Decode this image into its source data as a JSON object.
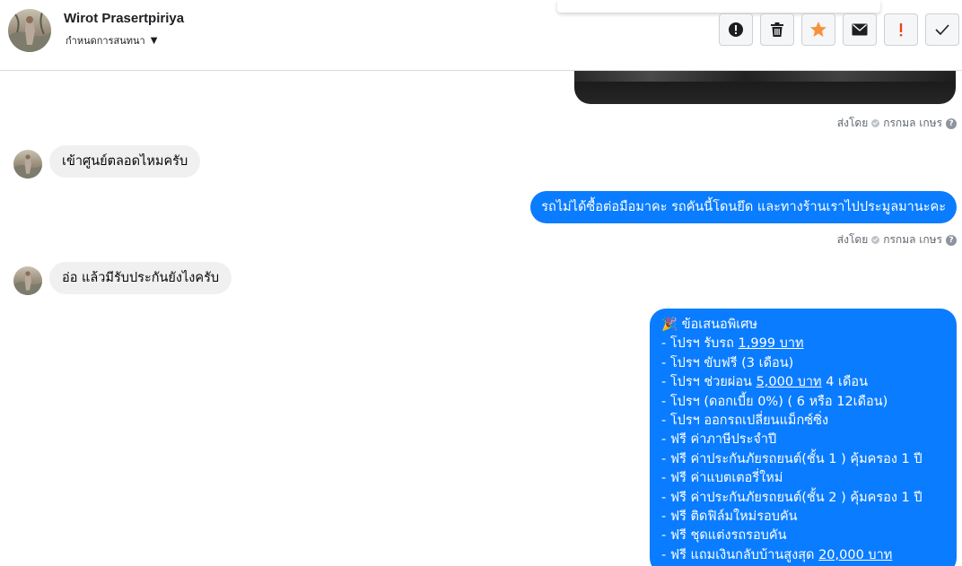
{
  "header": {
    "contact_name": "Wirot Prasertpiriya",
    "conversation_settings": "กำหนดการสนทนา",
    "actions": [
      {
        "icon": "alert-circle-icon"
      },
      {
        "icon": "trash-icon"
      },
      {
        "icon": "star-icon",
        "color": "#f7923b"
      },
      {
        "icon": "envelope-icon"
      },
      {
        "icon": "exclamation-icon",
        "color": "#e9461d"
      },
      {
        "icon": "check-icon"
      }
    ]
  },
  "thread": {
    "sent_by_label": "ส่งโดย",
    "sender_name": "กรกมล เกษร",
    "help_glyph": "?",
    "messages": [
      {
        "direction": "in",
        "text": "เข้าศูนย์ตลอดไหมครับ"
      },
      {
        "direction": "out",
        "text": "รถไม่ได้ซื้อต่อมือมาคะ รถคันนี้โดนยึด และทางร้านเราไปประมูลมานะคะ"
      },
      {
        "direction": "in",
        "text": "อ่อ แล้วมีรับประกันยังไงครับ"
      }
    ],
    "offer": {
      "emoji": "🎉",
      "title": "ข้อเสนอพิเศษ",
      "lines": [
        {
          "pre": "- โปรฯ รับรถ ",
          "link": "1,999 บาท",
          "post": ""
        },
        {
          "pre": "- โปรฯ ขับฟรี (3 เดือน)",
          "link": "",
          "post": ""
        },
        {
          "pre": "- โปรฯ ช่วยผ่อน ",
          "link": "5,000 บาท",
          "post": " 4 เดือน"
        },
        {
          "pre": "- โปรฯ (ดอกเบี้ย 0%) ( 6 หรือ 12เดือน)",
          "link": "",
          "post": ""
        },
        {
          "pre": "- โปรฯ ออกรถเปลี่ยนแม็กซ์ซิ่ง",
          "link": "",
          "post": ""
        },
        {
          "pre": "- ฟรี ค่าภาษีประจำปี",
          "link": "",
          "post": ""
        },
        {
          "pre": "- ฟรี ค่าประกันภัยรถยนต์(ชั้น 1 ) คุ้มครอง 1 ปี",
          "link": "",
          "post": ""
        },
        {
          "pre": "- ฟรี ค่าแบตเตอรี่ใหม่",
          "link": "",
          "post": ""
        },
        {
          "pre": "- ฟรี ค่าประกันภัยรถยนต์(ชั้น 2 ) คุ้มครอง 1 ปี",
          "link": "",
          "post": ""
        },
        {
          "pre": "- ฟรี ติดฟิล์มใหม่รอบคัน",
          "link": "",
          "post": ""
        },
        {
          "pre": "- ฟรี ชุดแต่งรถรอบคัน",
          "link": "",
          "post": ""
        },
        {
          "pre": "- ฟรี แถมเงินกลับบ้านสูงสุด ",
          "link": "20,000 บาท",
          "post": ""
        }
      ]
    }
  },
  "colors": {
    "outgoing_bubble": "#0a7cff",
    "incoming_bubble": "#f0f0f0",
    "star": "#f7923b",
    "exclamation": "#e9461d"
  }
}
